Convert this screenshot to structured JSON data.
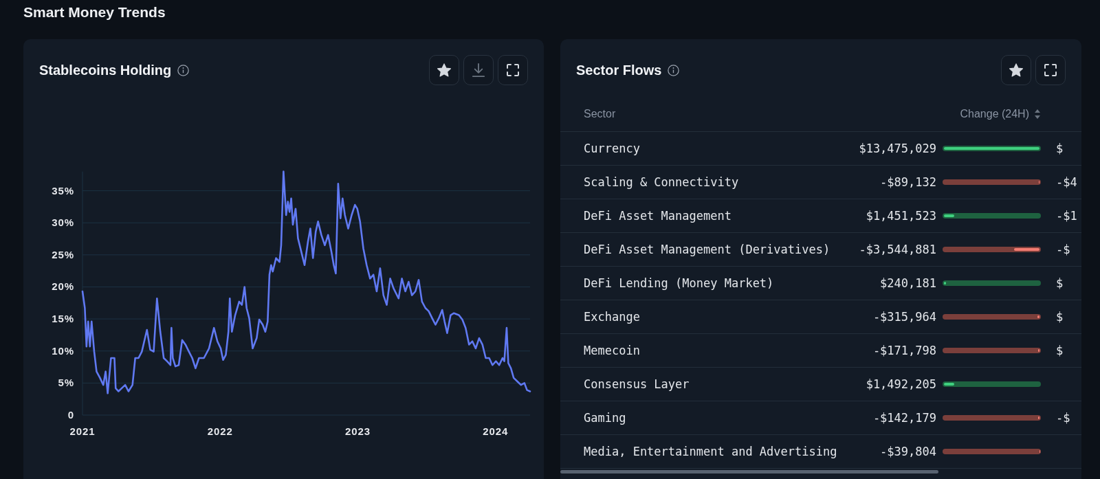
{
  "page": {
    "title": "Smart Money Trends"
  },
  "stablecoins_card": {
    "title": "Stablecoins Holding",
    "chart_data": {
      "type": "line",
      "grid": true,
      "x": [
        2021,
        2021.017,
        2021.029,
        2021.041,
        2021.054,
        2021.066,
        2021.085,
        2021.102,
        2021.127,
        2021.151,
        2021.168,
        2021.183,
        2021.207,
        2021.232,
        2021.241,
        2021.261,
        2021.285,
        2021.31,
        2021.334,
        2021.363,
        2021.383,
        2021.407,
        2021.431,
        2021.468,
        2021.492,
        2021.517,
        2021.541,
        2021.565,
        2021.59,
        2021.614,
        2021.639,
        2021.646,
        2021.656,
        2021.675,
        2021.699,
        2021.724,
        2021.748,
        2021.773,
        2021.797,
        2021.821,
        2021.846,
        2021.882,
        2021.919,
        2021.955,
        2021.98,
        2022.004,
        2022.021,
        2022.041,
        2022.06,
        2022.07,
        2022.085,
        2022.109,
        2022.138,
        2022.158,
        2022.177,
        2022.192,
        2022.211,
        2022.236,
        2022.265,
        2022.284,
        2022.309,
        2022.328,
        2022.345,
        2022.358,
        2022.37,
        2022.382,
        2022.406,
        2022.431,
        2022.443,
        2022.46,
        2022.479,
        2022.492,
        2022.504,
        2022.516,
        2022.528,
        2022.548,
        2022.565,
        2022.589,
        2022.613,
        2022.638,
        2022.655,
        2022.674,
        2022.694,
        2022.711,
        2022.735,
        2022.76,
        2022.784,
        2022.808,
        2022.825,
        2022.84,
        2022.857,
        2022.874,
        2022.889,
        2022.906,
        2022.93,
        2022.955,
        2022.979,
        2022.996,
        2023.016,
        2023.04,
        2023.064,
        2023.089,
        2023.113,
        2023.137,
        2023.162,
        2023.186,
        2023.21,
        2023.235,
        2023.259,
        2023.296,
        2023.32,
        2023.345,
        2023.369,
        2023.393,
        2023.418,
        2023.442,
        2023.466,
        2023.491,
        2023.515,
        2023.54,
        2023.564,
        2023.588,
        2023.613,
        2023.63,
        2023.649,
        2023.674,
        2023.698,
        2023.734,
        2023.759,
        2023.783,
        2023.808,
        2023.832,
        2023.856,
        2023.881,
        2023.905,
        2023.929,
        2023.954,
        2023.978,
        2024.003,
        2024.027,
        2024.051,
        2024.064,
        2024.081,
        2024.093,
        2024.112,
        2024.132,
        2024.161,
        2024.185,
        2024.21,
        2024.229,
        2024.251
      ],
      "series": [
        {
          "color": "#6079f2",
          "values": [
            19.3,
            16.7,
            10.7,
            14.6,
            10.7,
            14.6,
            9.9,
            6.8,
            5.8,
            4.7,
            6.8,
            3.4,
            8.9,
            8.9,
            4.2,
            3.7,
            4.2,
            4.7,
            3.7,
            4.7,
            8.9,
            8.9,
            9.9,
            13.3,
            10.2,
            9.9,
            18.2,
            13.0,
            8.9,
            8.4,
            7.8,
            13.6,
            8.9,
            7.6,
            7.8,
            11.7,
            11.0,
            9.9,
            8.9,
            7.3,
            8.9,
            8.9,
            10.4,
            13.6,
            11.5,
            10.4,
            8.6,
            9.4,
            13.0,
            18.2,
            13.0,
            15.6,
            17.7,
            17.2,
            20.0,
            16.7,
            15.1,
            10.4,
            12.0,
            14.9,
            14.1,
            13.0,
            14.6,
            21.9,
            23.4,
            22.4,
            24.5,
            23.9,
            26.5,
            38.0,
            31.2,
            33.3,
            31.7,
            33.8,
            29.7,
            32.2,
            27.6,
            25.5,
            23.4,
            27.1,
            29.1,
            24.5,
            28.6,
            30.2,
            28.1,
            26.5,
            28.1,
            25.5,
            23.4,
            22.1,
            36.1,
            30.7,
            33.8,
            31.2,
            29.1,
            31.2,
            32.8,
            32.2,
            30.2,
            26.0,
            23.4,
            21.3,
            21.9,
            19.3,
            22.9,
            18.7,
            17.2,
            21.3,
            19.8,
            18.2,
            21.3,
            19.3,
            20.8,
            18.7,
            19.3,
            21.1,
            17.7,
            16.7,
            16.2,
            15.1,
            14.1,
            15.1,
            16.4,
            14.6,
            12.8,
            15.6,
            15.9,
            15.6,
            14.9,
            13.6,
            11.0,
            11.5,
            10.4,
            12.0,
            11.0,
            8.9,
            8.9,
            7.8,
            8.4,
            7.8,
            8.9,
            8.4,
            13.6,
            8.1,
            7.3,
            5.8,
            5.2,
            4.7,
            5.0,
            3.9,
            3.7
          ]
        }
      ],
      "xlim": [
        2021,
        2024.251
      ],
      "ylim": [
        0,
        38
      ],
      "xticks": [
        {
          "value": 2021,
          "label": "2021"
        },
        {
          "value": 2022,
          "label": "2022"
        },
        {
          "value": 2023,
          "label": "2023"
        },
        {
          "value": 2024,
          "label": "2024"
        }
      ],
      "yticks": [
        {
          "value": 0,
          "label": "0"
        },
        {
          "value": 5,
          "label": "5%"
        },
        {
          "value": 10,
          "label": "10%"
        },
        {
          "value": 15,
          "label": "15%"
        },
        {
          "value": 20,
          "label": "20%"
        },
        {
          "value": 25,
          "label": "25%"
        },
        {
          "value": 30,
          "label": "30%"
        },
        {
          "value": 35,
          "label": "35%"
        }
      ]
    }
  },
  "sector_flows_card": {
    "title": "Sector Flows",
    "table": {
      "columns": [
        {
          "label": "Sector",
          "sortable": false
        },
        {
          "label": "Change (24H)",
          "sortable": true
        }
      ],
      "rows": [
        {
          "sector": "Currency",
          "change_24h": "$13,475,029",
          "kind": "gain",
          "level": 1,
          "column_3": "$"
        },
        {
          "sector": "Scaling & Connectivity",
          "change_24h": "-$89,132",
          "kind": "loss",
          "level": 0.007,
          "column_3": "-$4"
        },
        {
          "sector": "DeFi Asset Management",
          "change_24h": "$1,451,523",
          "kind": "gain",
          "level": 0.108,
          "column_3": "-$1"
        },
        {
          "sector": "DeFi Asset Management (Derivatives)",
          "change_24h": "-$3,544,881",
          "kind": "loss",
          "level": 0.263,
          "column_3": "-$"
        },
        {
          "sector": "DeFi Lending (Money Market)",
          "change_24h": "$240,181",
          "kind": "gain",
          "level": 0.018,
          "column_3": "$"
        },
        {
          "sector": "Exchange",
          "change_24h": "-$315,964",
          "kind": "loss",
          "level": 0.023,
          "column_3": "$"
        },
        {
          "sector": "Memecoin",
          "change_24h": "-$171,798",
          "kind": "loss",
          "level": 0.013,
          "column_3": "$"
        },
        {
          "sector": "Consensus Layer",
          "change_24h": "$1,492,205",
          "kind": "gain",
          "level": 0.111
        },
        {
          "sector": "Gaming",
          "change_24h": "-$142,179",
          "kind": "loss",
          "level": 0.011,
          "column_3": "-$"
        },
        {
          "sector": "Media, Entertainment and Advertising",
          "change_24h": "-$39,804",
          "kind": "loss",
          "level": 0.003
        }
      ]
    }
  }
}
